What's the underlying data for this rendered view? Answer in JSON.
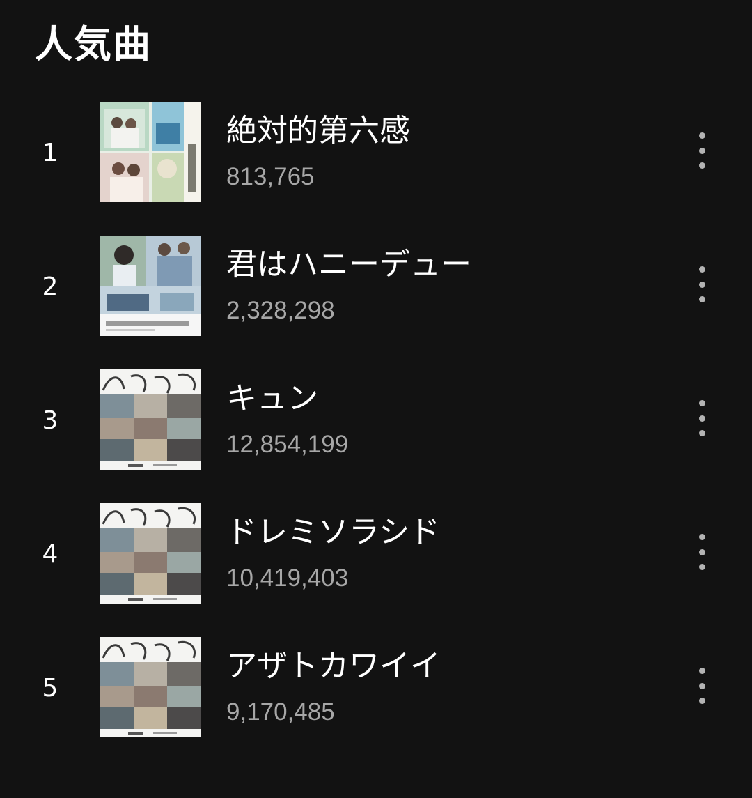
{
  "section": {
    "title": "人気曲"
  },
  "tracks": [
    {
      "rank": "1",
      "title": "絶対的第六感",
      "plays": "813,765",
      "cover": "cover-1"
    },
    {
      "rank": "2",
      "title": "君はハニーデュー",
      "plays": "2,328,298",
      "cover": "cover-2"
    },
    {
      "rank": "3",
      "title": "キュン",
      "plays": "12,854,199",
      "cover": "cover-hinatazaka"
    },
    {
      "rank": "4",
      "title": "ドレミソラシド",
      "plays": "10,419,403",
      "cover": "cover-hinatazaka"
    },
    {
      "rank": "5",
      "title": "アザトカワイイ",
      "plays": "9,170,485",
      "cover": "cover-hinatazaka"
    }
  ],
  "icons": {
    "more": "more-vertical-icon"
  },
  "colors": {
    "background": "#121212",
    "primary_text": "#ffffff",
    "secondary_text": "#a7a7a7"
  }
}
